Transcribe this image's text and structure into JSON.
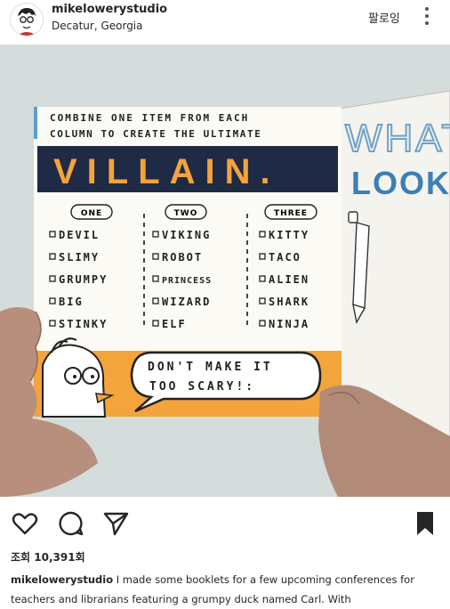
{
  "post": {
    "username": "mikelowerystudio",
    "location": "Decatur, Georgia",
    "follow_label": "팔로잉",
    "views": "조회 10,391회",
    "caption_user": "mikelowerystudio",
    "caption_text": " I made some booklets for a few upcoming conferences for teachers and librarians featuring a grumpy duck named Carl. With"
  },
  "book": {
    "intro_line1": "COMBINE ONE ITEM FROM EACH",
    "intro_line2": "COLUMN TO CREATE THE ULTIMATE",
    "banner": "VILLAIN.",
    "columns": [
      {
        "header": "ONE",
        "items": [
          "DEVIL",
          "SLIMY",
          "GRUMPY",
          "BIG",
          "STINKY"
        ]
      },
      {
        "header": "TWO",
        "items": [
          "VIKING",
          "ROBOT",
          "PRINCESS",
          "WIZARD",
          "ELF"
        ]
      },
      {
        "header": "THREE",
        "items": [
          "KITTY",
          "TACO",
          "ALIEN",
          "SHARK",
          "NINJA"
        ]
      }
    ],
    "speech_line1": "DON'T MAKE IT",
    "speech_line2": "TOO SCARY!:",
    "next_page_line1": "WHAT",
    "next_page_line2": "LOOK"
  },
  "icons": [
    "profile-avatar-icon",
    "more-options-icon",
    "heart-icon",
    "comment-icon",
    "share-icon",
    "bookmark-icon"
  ],
  "colors": {
    "banner": "#1f2a44",
    "accent": "#f3a43b",
    "page": "#fbfaf4"
  }
}
